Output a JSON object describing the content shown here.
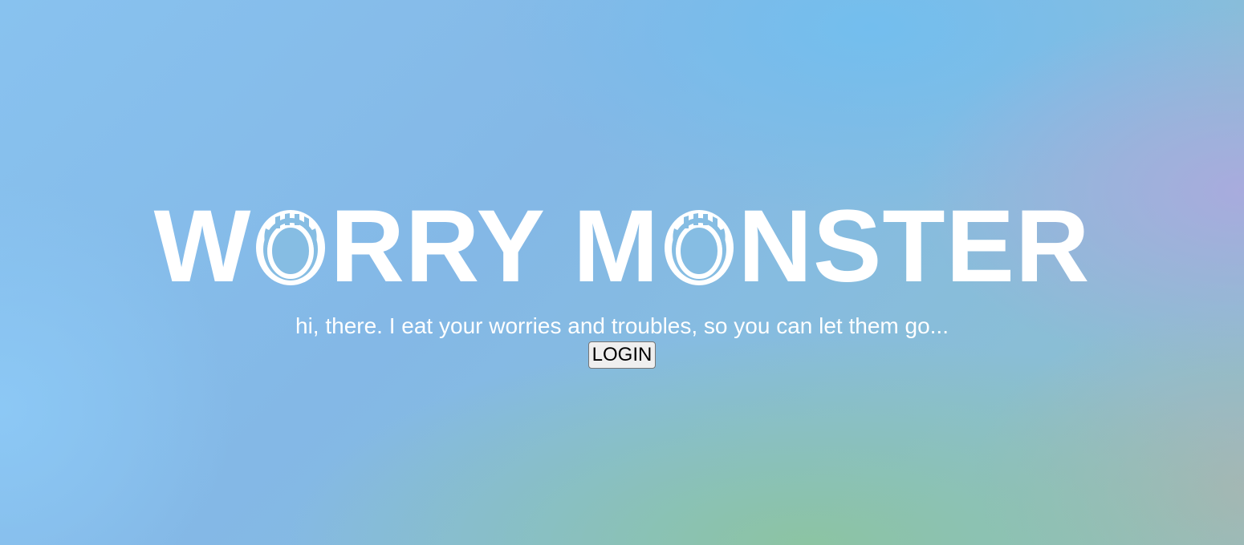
{
  "hero": {
    "title_letters": {
      "w": "W",
      "rry": "RRY",
      "m": "M",
      "nster": "NSTER"
    },
    "mouth_icon": "monster-mouth-icon",
    "tagline": "hi, there. I eat your worries and troubles, so you can let them go...",
    "login_label": "LOGIN"
  },
  "colors": {
    "text": "#ffffff",
    "button_bg": "#efefef"
  }
}
